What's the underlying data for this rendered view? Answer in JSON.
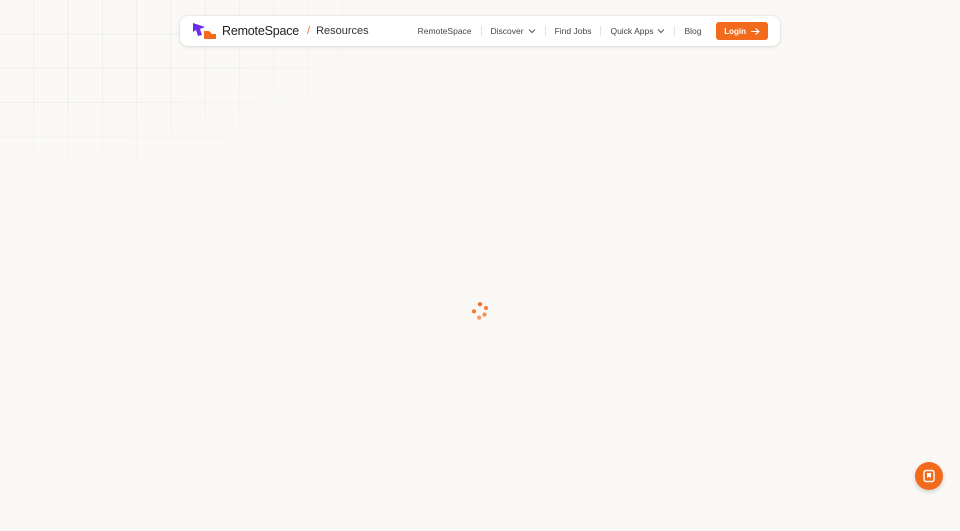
{
  "brand": {
    "name": "RemoteSpace",
    "separator": "/",
    "section": "Resources"
  },
  "nav": {
    "items": [
      {
        "label": "RemoteSpace",
        "has_dropdown": false
      },
      {
        "label": "Discover",
        "has_dropdown": true
      },
      {
        "label": "Find Jobs",
        "has_dropdown": false
      },
      {
        "label": "Quick Apps",
        "has_dropdown": true
      },
      {
        "label": "Blog",
        "has_dropdown": false
      }
    ],
    "login_label": "Login"
  },
  "icons": {
    "logo": "remotespace-logo-icon",
    "login_arrow": "arrow-right-icon",
    "spinner": "loading-spinner-icon",
    "fab": "bookmark-icon"
  },
  "colors": {
    "accent": "#f26b1d",
    "logo_purple": "#6a2ee8",
    "background": "#faf9f6"
  }
}
